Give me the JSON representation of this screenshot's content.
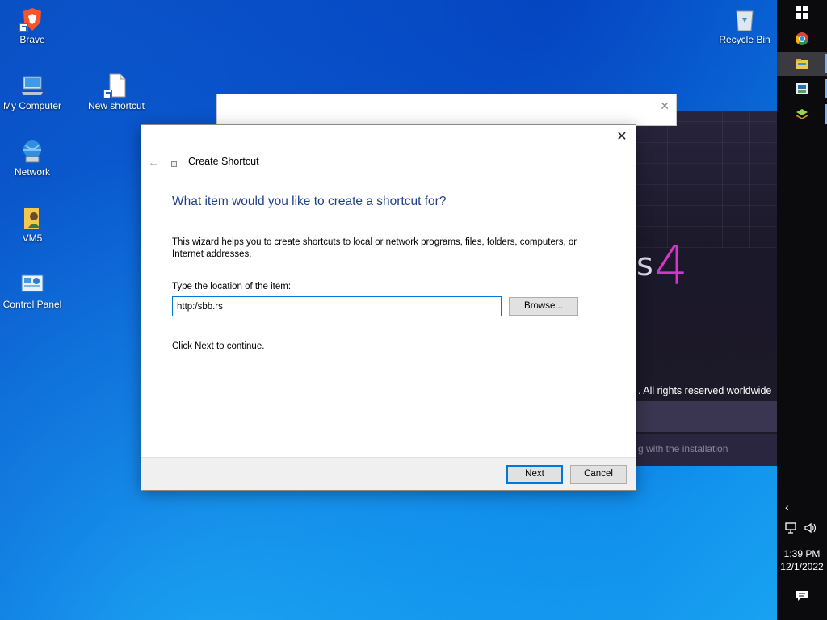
{
  "desktop": {
    "icons": [
      {
        "label": "Brave",
        "icon": "brave-icon"
      },
      {
        "label": "My Computer",
        "icon": "computer-icon"
      },
      {
        "label": "New shortcut",
        "icon": "shortcut-file-icon"
      },
      {
        "label": "Network",
        "icon": "network-icon"
      },
      {
        "label": "VM5",
        "icon": "user-folder-icon"
      },
      {
        "label": "Control Panel",
        "icon": "control-panel-icon"
      },
      {
        "label": "Recycle Bin",
        "icon": "recycle-bin-icon"
      }
    ]
  },
  "installer": {
    "brand_s": "s",
    "brand_4": "4",
    "rights": ". All rights reserved worldwide",
    "status": "g with the installation"
  },
  "wizard": {
    "title": "Create Shortcut",
    "heading": "What item would you like to create a shortcut for?",
    "description": "This wizard helps you to create shortcuts to local or network programs, files, folders, computers, or Internet addresses.",
    "location_label": "Type the location of the item:",
    "location_value": "http:/sbb.rs",
    "browse_label": "Browse...",
    "hint": "Click Next to continue.",
    "next_label": "Next",
    "cancel_label": "Cancel",
    "close_glyph": "✕",
    "back_glyph": "←"
  },
  "taskbar": {
    "time": "1:39 PM",
    "date": "12/1/2022",
    "apps": [
      "windows-start-icon",
      "chrome-icon",
      "file-explorer-icon",
      "app-icon",
      "layers-icon"
    ],
    "tray": [
      "chevron-left-icon",
      "network-icon",
      "volume-icon",
      "notification-icon"
    ]
  }
}
